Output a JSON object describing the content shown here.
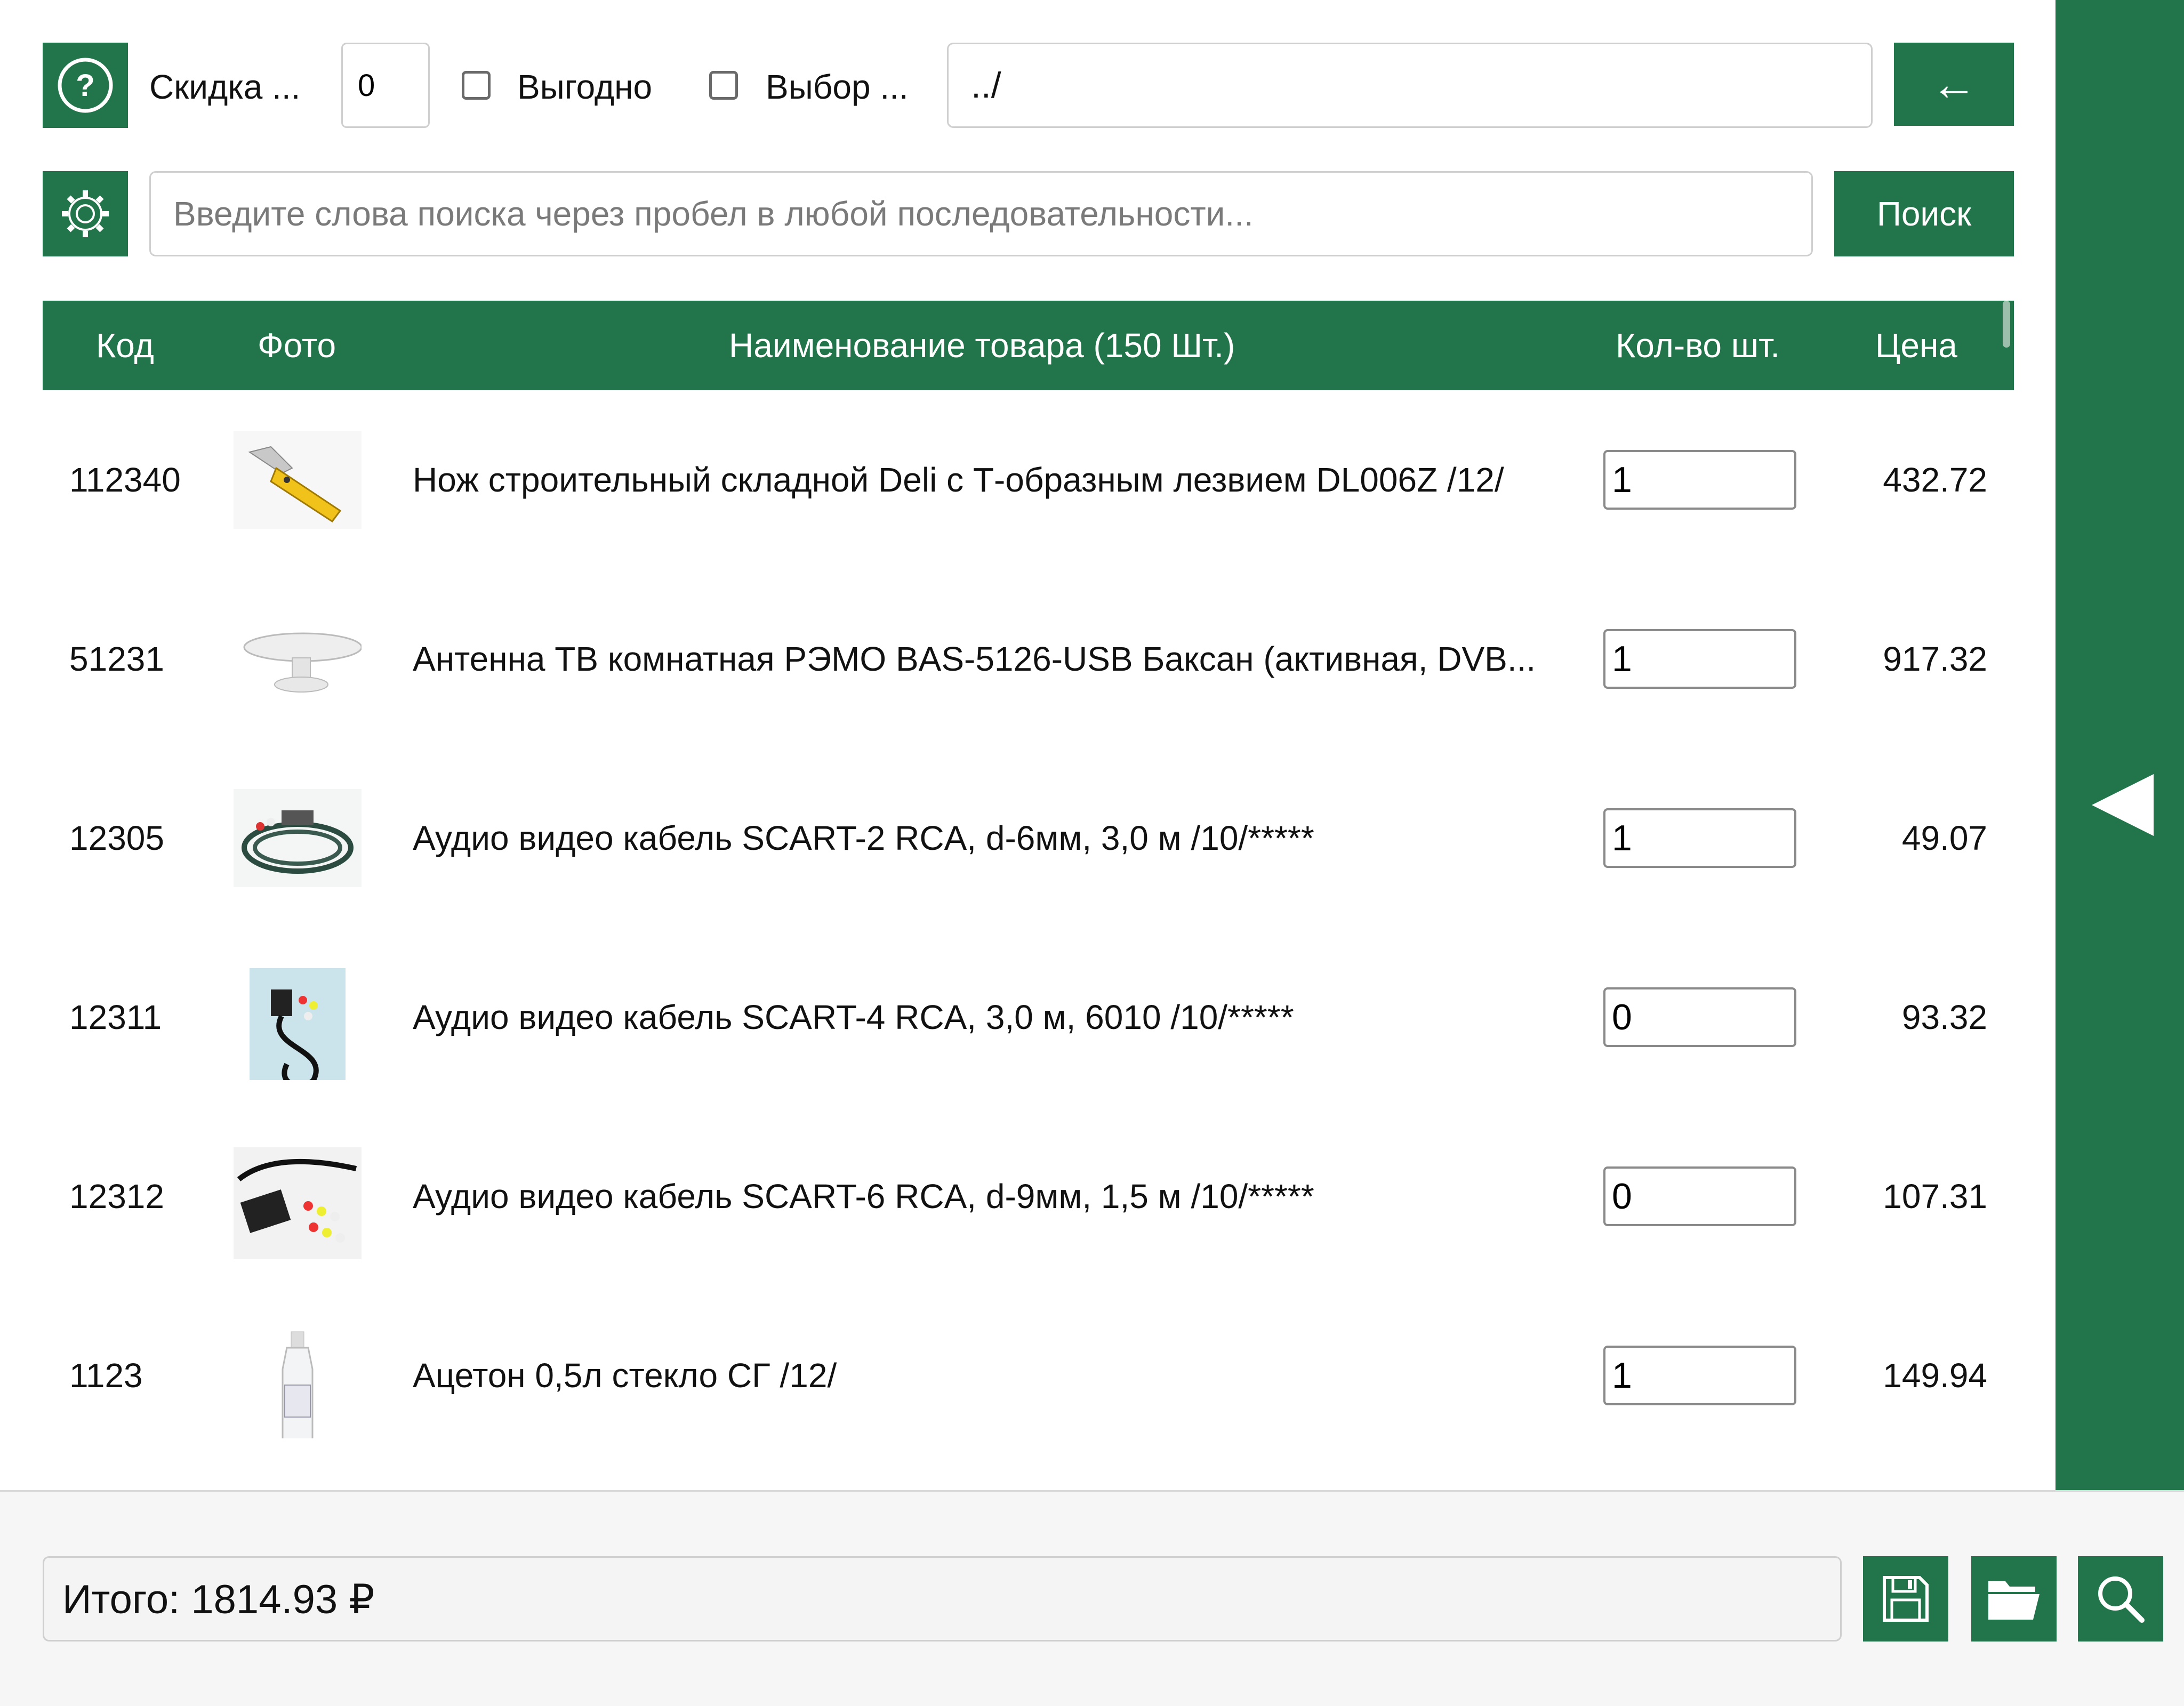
{
  "toolbar": {
    "discount_label": "Скидка ...",
    "discount_value": "0",
    "profitable_label": "Выгодно",
    "choice_label": "Выбор ...",
    "path": "../",
    "back_label": "←",
    "search_placeholder": "Введите слова поиска через пробел в любой последовательности...",
    "search_label": "Поиск"
  },
  "table": {
    "headers": {
      "code": "Код",
      "photo": "Фото",
      "name": "Наименование товара (150 Шт.)",
      "qty": "Кол-во шт.",
      "price": "Цена"
    },
    "rows": [
      {
        "code": "112340",
        "name": "Нож строительный складной Deli с Т-образным лезвием DL006Z /12/",
        "qty": "1",
        "price": "432.72",
        "photo_icon": "folding-knife-photo"
      },
      {
        "code": "51231",
        "name": "Антенна ТВ комнатная РЭМО BAS-5126-USB Баксан (активная, DVB...",
        "qty": "1",
        "price": "917.32",
        "photo_icon": "antenna-photo"
      },
      {
        "code": "12305",
        "name": "Аудио видео кабель SCART-2 RCA, d-6мм, 3,0 м /10/*****",
        "qty": "1",
        "price": "49.07",
        "photo_icon": "cable-photo"
      },
      {
        "code": "12311",
        "name": "Аудио видео кабель SCART-4 RCA, 3,0 м, 6010 /10/*****",
        "qty": "0",
        "price": "93.32",
        "photo_icon": "cable-photo"
      },
      {
        "code": "12312",
        "name": "Аудио видео кабель SCART-6 RCA, d-9мм, 1,5 м /10/*****",
        "qty": "0",
        "price": "107.31",
        "photo_icon": "cable-photo"
      },
      {
        "code": "1123",
        "name": "Ацетон 0,5л стекло СГ /12/",
        "qty": "1",
        "price": "149.94",
        "photo_icon": "bottle-photo"
      }
    ]
  },
  "footer": {
    "total": "Итого: 1814.93 ₽"
  },
  "colors": {
    "accent": "#22744a"
  }
}
